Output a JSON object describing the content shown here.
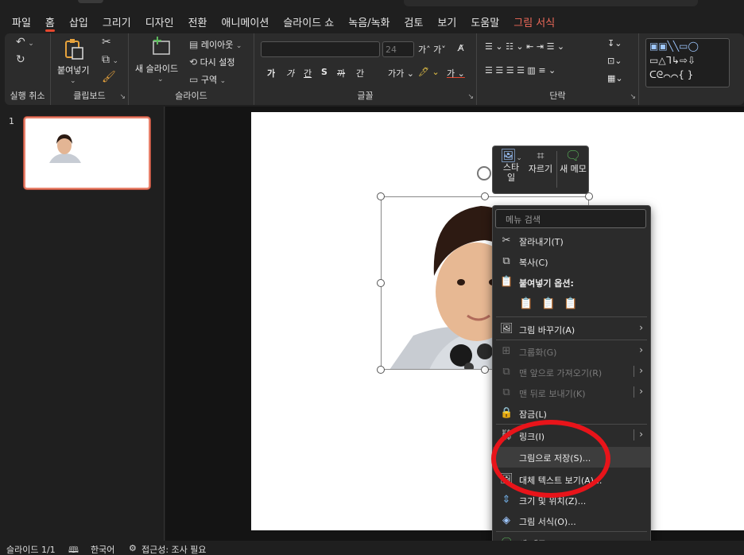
{
  "tabs": [
    "파일",
    "홈",
    "삽입",
    "그리기",
    "디자인",
    "전환",
    "애니메이션",
    "슬라이드 쇼",
    "녹음/녹화",
    "검토",
    "보기",
    "도움말",
    "그림 서식"
  ],
  "active_tab": "홈",
  "accent_tab": "그림 서식",
  "ribbon": {
    "groups": {
      "undo": "실행 취소",
      "clipboard": "클립보드",
      "slides": "슬라이드",
      "font": "글꼴",
      "paragraph": "단락"
    },
    "paste_label": "붙여넣기",
    "new_slide_label": "새 슬라이드",
    "layout_label": "레이아웃",
    "reset_label": "다시 설정",
    "section_label": "구역",
    "font_size": "24",
    "font_buttons": [
      "가",
      "가",
      "간",
      "S",
      "까",
      "간"
    ]
  },
  "thumbnail": {
    "slide_number": "1"
  },
  "mini_toolbar": {
    "style_label": "스타일",
    "crop_label": "자르기",
    "new_comment_label": "새 메모"
  },
  "context_menu": {
    "search_placeholder": "메뉴 검색",
    "items": {
      "cut": "잘라내기(T)",
      "copy": "복사(C)",
      "paste_options": "붙여넣기 옵션:",
      "change_picture": "그림 바꾸기(A)",
      "group": "그룹화(G)",
      "bring_front": "맨 앞으로 가져오기(R)",
      "send_back": "맨 뒤로 보내기(K)",
      "lock": "잠금(L)",
      "link": "링크(I)",
      "save_as_picture": "그림으로 저장(S)...",
      "alt_text": "대체 텍스트 보기(A)...",
      "size_position": "크기 및 위치(Z)...",
      "format_picture": "그림 서식(O)...",
      "new_comment": "새 메모(M)"
    }
  },
  "status_bar": {
    "slide_info": "슬라이드 1/1",
    "language": "한국어",
    "accessibility": "접근성: 조사 필요"
  },
  "colors": {
    "accent": "#e6472e",
    "highlight_circle": "#e8141a"
  }
}
